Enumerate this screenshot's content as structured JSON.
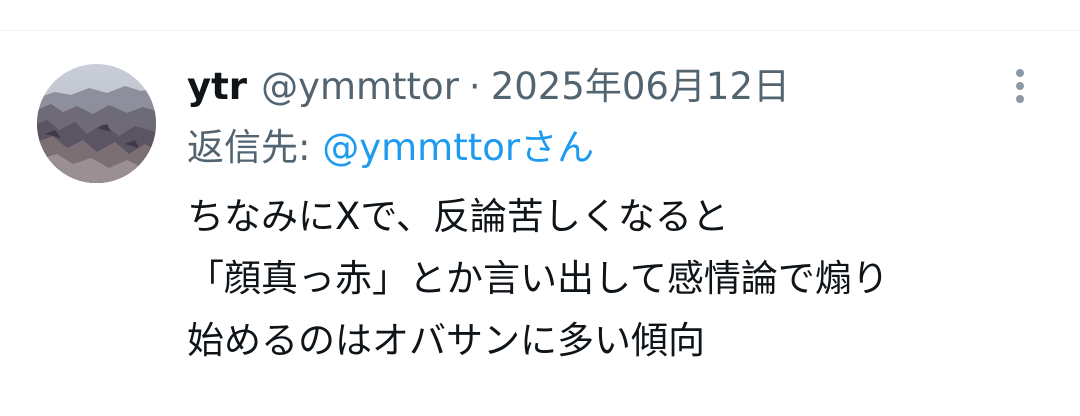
{
  "tweet": {
    "display_name": "ytr",
    "handle": "@ymmttor",
    "separator": "·",
    "date": "2025年06月12日",
    "reply_prefix": "返信先:",
    "reply_mention": "@ymmttorさん",
    "body_lines": [
      "ちなみにXで、反論苦しくなると",
      "「顔真っ赤」とか言い出して感情論で煽り",
      "始めるのはオバサンに多い傾向"
    ],
    "more_icon": "more-vertical-icon",
    "avatar_icon": "landscape-avatar"
  },
  "colors": {
    "name": "#0f1419",
    "secondary": "#536471",
    "mention": "#1d9bf0",
    "divider": "#eff3f4"
  }
}
